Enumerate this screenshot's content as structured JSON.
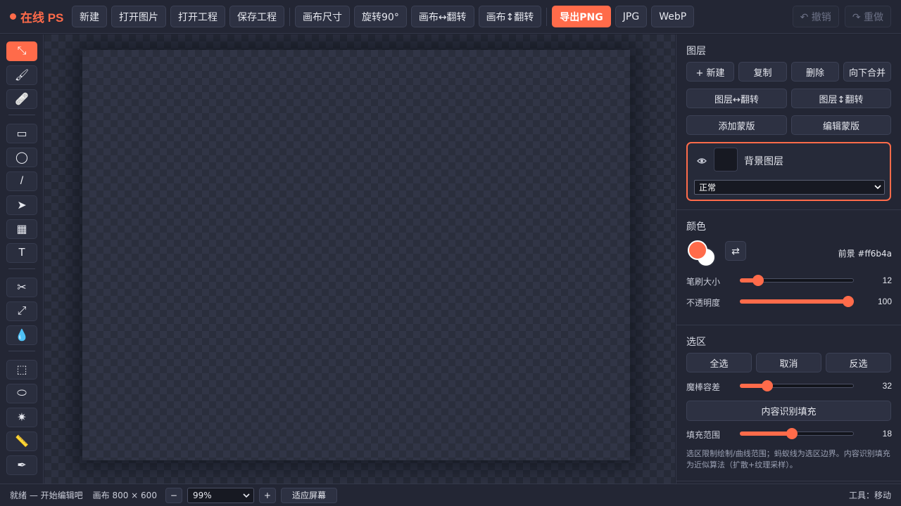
{
  "app": {
    "title": "在线 PS",
    "accent": "#ff6b4a"
  },
  "toolbar": {
    "new": "新建",
    "open_image": "打开图片",
    "open_project": "打开工程",
    "save_project": "保存工程",
    "canvas_size": "画布尺寸",
    "rotate_90": "旋转90°",
    "flip_canvas_h": "画布↔翻转",
    "flip_canvas_v": "画布↕翻转",
    "export_png": "导出PNG",
    "export_jpg": "JPG",
    "export_webp": "WebP",
    "undo": "↶ 撤销",
    "redo": "↷ 重做"
  },
  "tools": [
    {
      "name": "move-tool",
      "glyph": "⤡",
      "active": true
    },
    {
      "name": "brush-tool",
      "glyph": "🖌",
      "active": false
    },
    {
      "name": "eraser-tool",
      "glyph": "🩹",
      "active": false
    },
    {
      "name": "rectangle-tool",
      "glyph": "▭",
      "active": false
    },
    {
      "name": "ellipse-tool",
      "glyph": "◯",
      "active": false
    },
    {
      "name": "line-tool",
      "glyph": "/",
      "active": false
    },
    {
      "name": "arrow-tool",
      "glyph": "➤",
      "active": false
    },
    {
      "name": "grid-tool",
      "glyph": "▦",
      "active": false
    },
    {
      "name": "text-tool",
      "glyph": "T",
      "active": false
    },
    {
      "name": "crop-tool",
      "glyph": "✂",
      "active": false
    },
    {
      "name": "transform-tool",
      "glyph": "⤢",
      "active": false
    },
    {
      "name": "eyedropper-tool",
      "glyph": "💧",
      "active": false
    },
    {
      "name": "rect-select-tool",
      "glyph": "⬚",
      "active": false
    },
    {
      "name": "ellipse-select-tool",
      "glyph": "⬭",
      "active": false
    },
    {
      "name": "magic-wand-tool",
      "glyph": "✷",
      "active": false
    },
    {
      "name": "ruler-tool",
      "glyph": "📏",
      "active": false
    },
    {
      "name": "lasso-tool",
      "glyph": "✒",
      "active": false
    }
  ],
  "layers": {
    "title": "图层",
    "new": "+ 新建",
    "duplicate": "复制",
    "delete": "删除",
    "merge_down": "向下合并",
    "flip_h": "图层↔翻转",
    "flip_v": "图层↕翻转",
    "add_mask": "添加蒙版",
    "edit_mask": "编辑蒙版",
    "item": {
      "name": "背景图层",
      "blend_mode": "正常",
      "visible": true
    }
  },
  "color": {
    "title": "颜色",
    "foreground": "#ff6b4a",
    "background": "#ffffff",
    "foreground_label": "前景 #ff6b4a",
    "brush_size_label": "笔刷大小",
    "brush_size": 12,
    "brush_size_max": 100,
    "opacity_label": "不透明度",
    "opacity": 100,
    "opacity_max": 100
  },
  "selection": {
    "title": "选区",
    "select_all": "全选",
    "deselect": "取消",
    "invert": "反选",
    "wand_tolerance_label": "魔棒容差",
    "wand_tolerance": 32,
    "wand_tolerance_max": 150,
    "content_aware_fill": "内容识别填充",
    "fill_range_label": "填充范围",
    "fill_range": 18,
    "fill_range_max": 40,
    "hint": "选区限制绘制/曲线范围；蚂蚁线为选区边界。内容识别填充为近似算法（扩散+纹理采样）。"
  },
  "status": {
    "message": "就绪 — 开始编辑吧",
    "canvas_info": "画布 800 × 600",
    "zoom_out": "−",
    "zoom": "99%",
    "zoom_in": "+",
    "fit_screen": "适应屏幕",
    "current_tool": "工具：移动"
  }
}
